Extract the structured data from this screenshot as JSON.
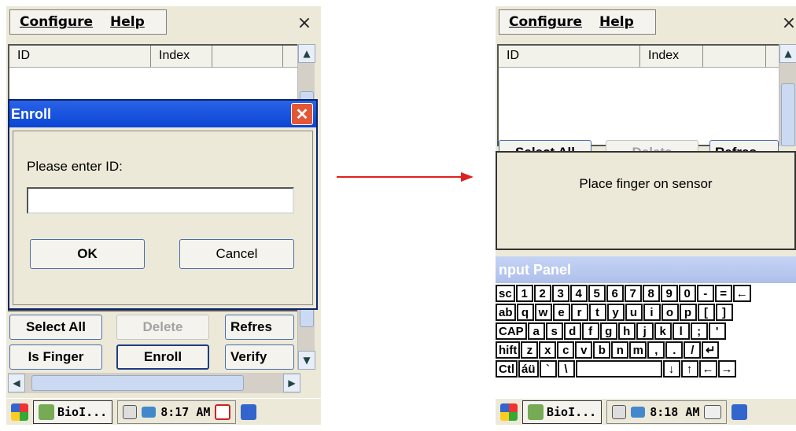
{
  "left": {
    "menu": {
      "configure": "Configure",
      "help": "Help"
    },
    "close": "×",
    "list_columns": [
      "ID",
      "Index"
    ],
    "buttons": {
      "select_all": "Select All",
      "delete": "Delete",
      "refresh": "Refres",
      "is_finger": "Is Finger",
      "enroll": "Enroll",
      "verify": "Verify"
    },
    "dialog": {
      "title": "Enroll",
      "prompt": "Please enter ID:",
      "ok": "OK",
      "cancel": "Cancel",
      "input_value": ""
    },
    "taskbar": {
      "app": "BioI...",
      "time": "8:17 AM"
    }
  },
  "right": {
    "menu": {
      "configure": "Configure",
      "help": "Help"
    },
    "close": "×",
    "list_columns": [
      "ID",
      "Index"
    ],
    "buttons": {
      "select_all": "Select All",
      "delete": "Delete",
      "refresh": "Refres"
    },
    "message": "Place finger on sensor",
    "input_panel_title": "nput Panel",
    "keyboard": [
      [
        "sc",
        "1",
        "2",
        "3",
        "4",
        "5",
        "6",
        "7",
        "8",
        "9",
        "0",
        "-",
        "=",
        "←"
      ],
      [
        "ab",
        "q",
        "w",
        "e",
        "r",
        "t",
        "y",
        "u",
        "i",
        "o",
        "p",
        "[",
        "]"
      ],
      [
        "CAP",
        "a",
        "s",
        "d",
        "f",
        "g",
        "h",
        "j",
        "k",
        "l",
        ";",
        "'"
      ],
      [
        "hift",
        "z",
        "x",
        "c",
        "v",
        "b",
        "n",
        "m",
        ",",
        ".",
        "/",
        "↵"
      ],
      [
        "Ctl",
        "áü",
        "`",
        "\\",
        " ",
        "↓",
        "↑",
        "←",
        "→"
      ]
    ],
    "taskbar": {
      "app": "BioI...",
      "time": "8:18 AM"
    }
  },
  "colors": {
    "arrow": "#e02020",
    "title_blue": "#0a46d4",
    "close_red": "#e35735"
  }
}
